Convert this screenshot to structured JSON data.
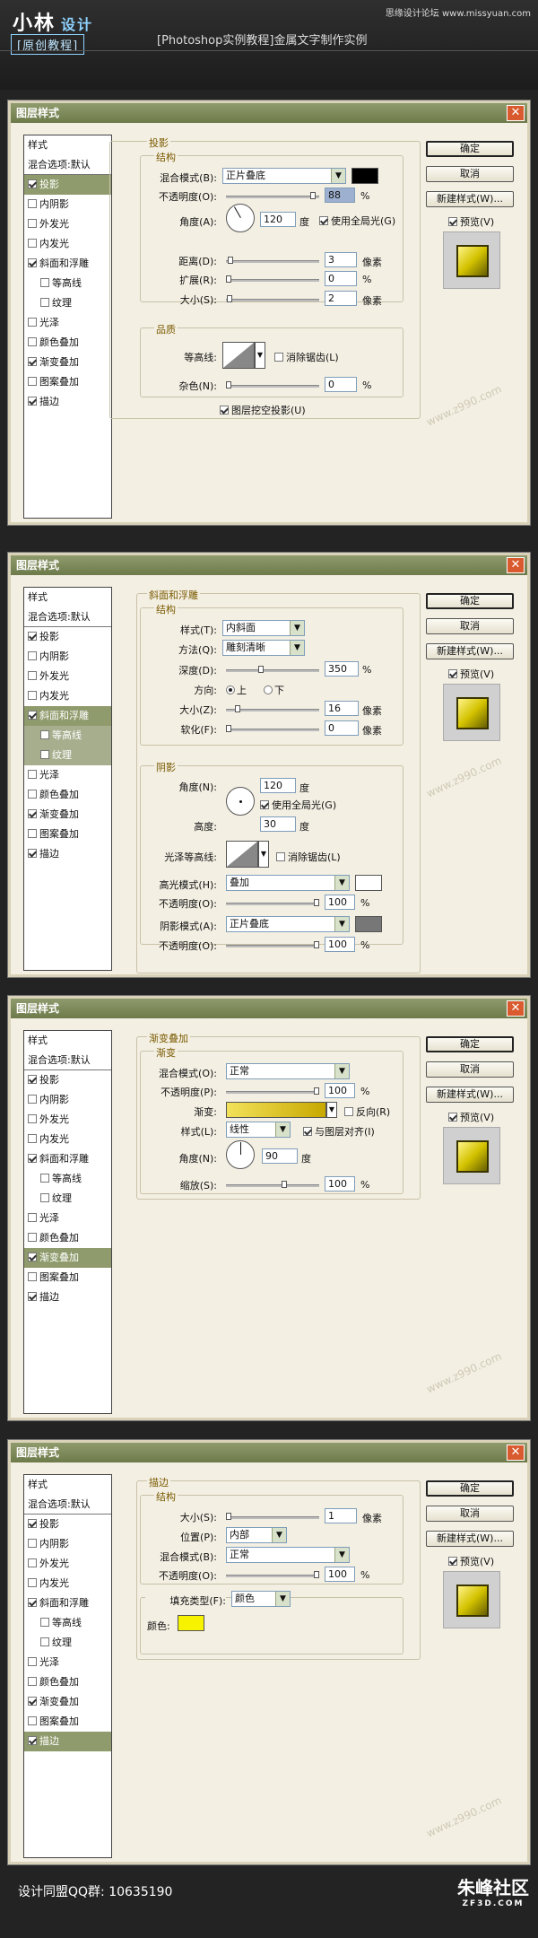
{
  "header": {
    "logo_main": "小林",
    "logo_sub": "设计",
    "badge": "[原创教程]",
    "top_right": "思缘设计论坛 www.missyuan.com",
    "title": "[Photoshop实例教程]金属文字制作实例"
  },
  "dialog_title": "图层样式",
  "close_glyph": "✕",
  "buttons": {
    "ok": "确定",
    "cancel": "取消",
    "new_style": "新建样式(W)...",
    "preview": "预览(V)"
  },
  "styles_list": {
    "header": "样式",
    "blend_default": "混合选项:默认",
    "items": [
      "投影",
      "内阴影",
      "外发光",
      "内发光",
      "斜面和浮雕",
      "等高线",
      "纹理",
      "光泽",
      "颜色叠加",
      "渐变叠加",
      "图案叠加",
      "描边"
    ]
  },
  "watermark": "www.z990.com",
  "colors": {
    "black": "#000000",
    "white": "#ffffff",
    "gray": "#777777",
    "yellow": "#f7f200",
    "gradient_from": "#f2e25a",
    "gradient_to": "#c8a800"
  },
  "common": {
    "blend_mode": "混合模式(B):",
    "opacity": "不透明度(O):",
    "angle": "角度(A):",
    "size": "大小(S):",
    "pixels": "像素",
    "percent": "%",
    "degree": "度",
    "global_light": "使用全局光(G)",
    "structure": "结构"
  },
  "d1": {
    "section": "投影",
    "mode": "正片叠底",
    "opacity": "88",
    "angle": "120",
    "distance_label": "距离(D):",
    "distance": "3",
    "spread_label": "扩展(R):",
    "spread": "0",
    "size": "2",
    "quality": "品质",
    "contour_label": "等高线:",
    "anti_alias": "消除锯齿(L)",
    "noise_label": "杂色(N):",
    "noise": "0",
    "knockout": "图层挖空投影(U)"
  },
  "d2": {
    "section": "斜面和浮雕",
    "style_label": "样式(T):",
    "style": "内斜面",
    "method_label": "方法(Q):",
    "method": "雕刻清晰",
    "depth_label": "深度(D):",
    "depth": "350",
    "direction_label": "方向:",
    "dir_up": "上",
    "dir_down": "下",
    "size_label": "大小(Z):",
    "size": "16",
    "soften_label": "软化(F):",
    "soften": "0",
    "shading": "阴影",
    "angle_label": "角度(N):",
    "angle": "120",
    "altitude_label": "高度:",
    "altitude": "30",
    "gloss_label": "光泽等高线:",
    "anti_alias": "消除锯齿(L)",
    "hl_mode_label": "高光模式(H):",
    "hl_mode": "叠加",
    "hl_opacity": "100",
    "sh_mode_label": "阴影模式(A):",
    "sh_mode": "正片叠底",
    "sh_opacity": "100"
  },
  "d3": {
    "section": "渐变叠加",
    "sub": "渐变",
    "blend_label": "混合模式(O):",
    "mode": "正常",
    "opacity_label": "不透明度(P):",
    "opacity": "100",
    "gradient_label": "渐变:",
    "reverse": "反向(R)",
    "style_label": "样式(L):",
    "style": "线性",
    "align": "与图层对齐(I)",
    "angle_label": "角度(N):",
    "angle": "90",
    "scale_label": "缩放(S):",
    "scale": "100"
  },
  "d4": {
    "section": "描边",
    "size": "1",
    "position_label": "位置(P):",
    "position": "内部",
    "mode": "正常",
    "opacity": "100",
    "fill_label": "填充类型(F):",
    "fill": "颜色",
    "color_label": "颜色:"
  },
  "footer": {
    "qq": "设计同盟QQ群: 10635190",
    "brand": "朱峰社区",
    "brand_url": "ZF3D.COM"
  }
}
